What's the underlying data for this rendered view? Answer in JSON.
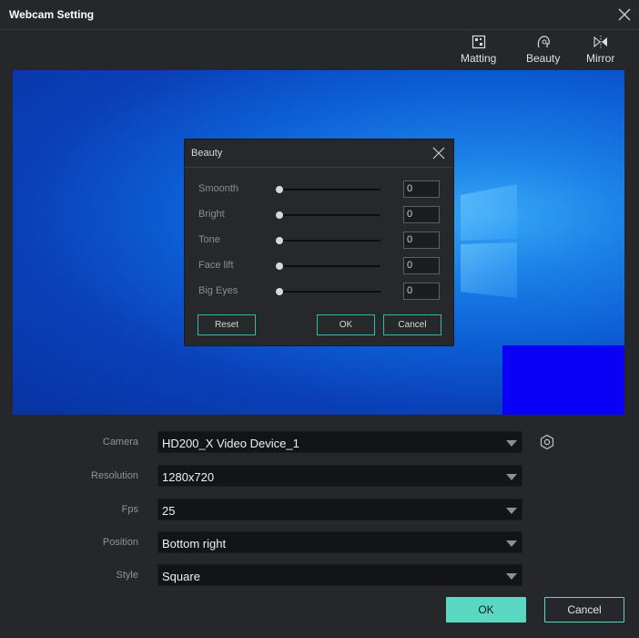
{
  "window": {
    "title": "Webcam Setting"
  },
  "toolbar": {
    "matting": "Matting",
    "beauty": "Beauty",
    "mirror": "Mirror"
  },
  "beauty_dialog": {
    "title": "Beauty",
    "sliders": [
      {
        "label": "Smoonth",
        "value": "0"
      },
      {
        "label": "Bright",
        "value": "0"
      },
      {
        "label": "Tone",
        "value": "0"
      },
      {
        "label": "Face lift",
        "value": "0"
      },
      {
        "label": "Big Eyes",
        "value": "0"
      }
    ],
    "reset_label": "Reset",
    "ok_label": "OK",
    "cancel_label": "Cancel"
  },
  "settings": {
    "camera_label": "Camera",
    "camera_value": "HD200_X Video Device_1",
    "resolution_label": "Resolution",
    "resolution_value": "1280x720",
    "fps_label": "Fps",
    "fps_value": "25",
    "position_label": "Position",
    "position_value": "Bottom right",
    "style_label": "Style",
    "style_value": "Square"
  },
  "footer": {
    "ok_label": "OK",
    "cancel_label": "Cancel"
  },
  "colors": {
    "accent": "#5ad8c3",
    "background": "#25272b",
    "pip": "#0a00f5"
  }
}
